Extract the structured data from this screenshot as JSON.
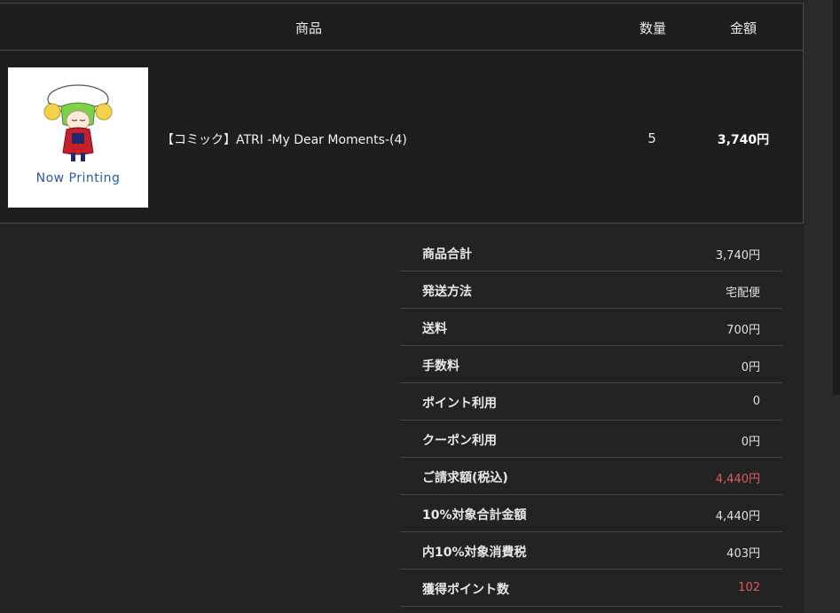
{
  "table": {
    "headers": {
      "product": "商品",
      "quantity": "数量",
      "amount": "金額"
    },
    "item": {
      "thumbnail_text": "Now Printing",
      "name": "【コミック】ATRI -My Dear Moments-(4)",
      "quantity": "5",
      "price": "3,740円"
    }
  },
  "summary": {
    "rows": [
      {
        "label": "商品合計",
        "value": "3,740円",
        "highlight": false
      },
      {
        "label": "発送方法",
        "value": "宅配便",
        "highlight": false
      },
      {
        "label": "送料",
        "value": "700円",
        "highlight": false
      },
      {
        "label": "手数料",
        "value": "0円",
        "highlight": false
      },
      {
        "label": "ポイント利用",
        "value": "0",
        "highlight": false
      },
      {
        "label": "クーポン利用",
        "value": "0円",
        "highlight": false
      },
      {
        "label": "ご請求額(税込)",
        "value": "4,440円",
        "highlight": true
      },
      {
        "label": "10%対象合計金額",
        "value": "4,440円",
        "highlight": false
      },
      {
        "label": "内10%対象消費税",
        "value": "403円",
        "highlight": false
      },
      {
        "label": "獲得ポイント数",
        "value": "102",
        "highlight": true
      }
    ]
  },
  "colors": {
    "background": "#232323",
    "table_bg": "#1e1e20",
    "highlight": "#e05a5a",
    "now_printing": "#2a5aa8"
  }
}
